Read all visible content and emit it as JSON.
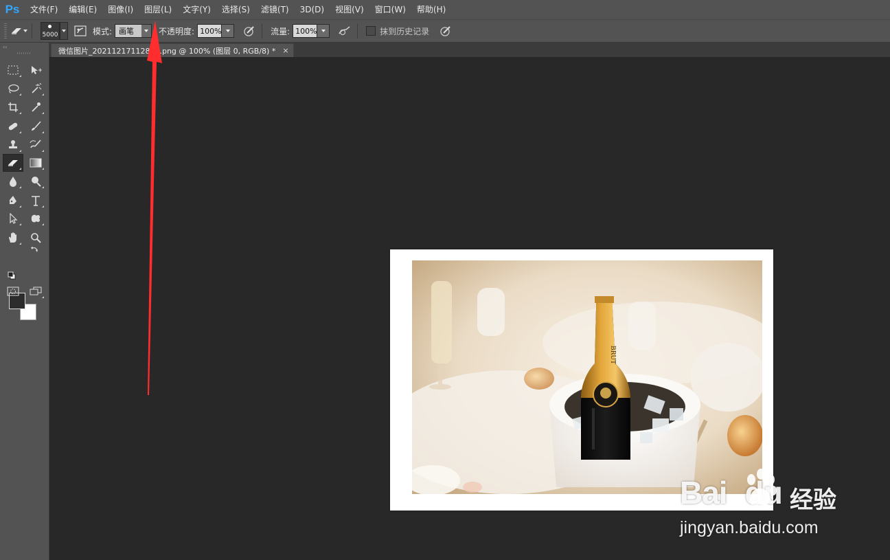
{
  "app": {
    "logo": "Ps",
    "accent": "#31a8ff"
  },
  "menu": [
    {
      "label": "文件(F)"
    },
    {
      "label": "编辑(E)"
    },
    {
      "label": "图像(I)"
    },
    {
      "label": "图层(L)"
    },
    {
      "label": "文字(Y)"
    },
    {
      "label": "选择(S)"
    },
    {
      "label": "滤镜(T)"
    },
    {
      "label": "3D(D)"
    },
    {
      "label": "视图(V)"
    },
    {
      "label": "窗口(W)"
    },
    {
      "label": "帮助(H)"
    }
  ],
  "options": {
    "tool_icon": "eraser-icon",
    "brush_size": "5000",
    "mode_label": "模式:",
    "mode_value": "画笔",
    "opacity_label": "不透明度:",
    "opacity_value": "100%",
    "flow_label": "流量:",
    "flow_value": "100%",
    "history_label": "抹到历史记录",
    "history_checked": false
  },
  "document": {
    "tab_title": "微信图片_20211217112811.png @ 100% (图层 0, RGB/8) *",
    "close_glyph": "×"
  },
  "toolbar": {
    "collapse_glyph": "‹‹",
    "active_tool": "eraser-tool",
    "foreground_color": "#2c2c2c",
    "background_color": "#ffffff"
  },
  "photo": {
    "bottle_label": "BRUT",
    "annotation_color": "#ff2d2d"
  },
  "watermark": {
    "brand": "Bai",
    "brand2": "du",
    "suffix": "经验",
    "url": "jingyan.baidu.com"
  }
}
